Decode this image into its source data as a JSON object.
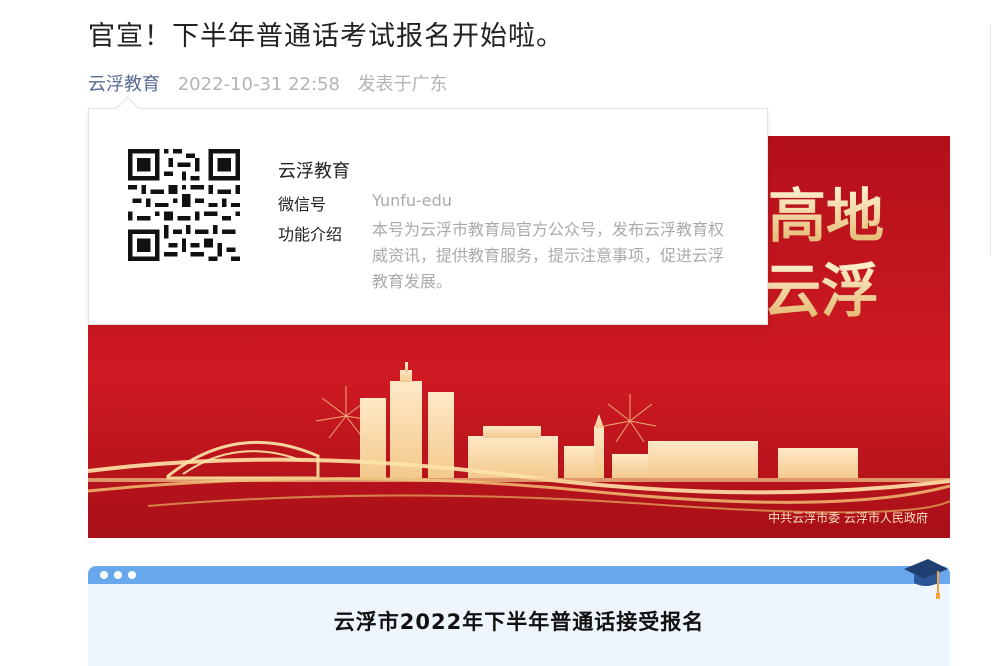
{
  "article": {
    "title": "官宣！下半年普通话考试报名开始啦。",
    "author": "云浮教育",
    "date": "2022-10-31 22:58",
    "location": "发表于广东"
  },
  "banner": {
    "headline_part1": "高地",
    "headline_part2": "云浮",
    "credit": "中共云浮市委  云浮市人民政府"
  },
  "profile_popup": {
    "name": "云浮教育",
    "wechat_label": "微信号",
    "wechat_id": "Yunfu-edu",
    "intro_label": "功能介绍",
    "intro": "本号为云浮市教育局官方公众号，发布云浮教育权威资讯，提供教育服务，提示注意事项，促进云浮教育发展。"
  },
  "card": {
    "title": "云浮市2022年下半年普通话接受报名"
  },
  "colors": {
    "author_link": "#576b95",
    "banner_red": "#c4141b",
    "gold": "#f1cf8c",
    "card_bar": "#6aa8ee",
    "card_bg": "#eef5fd"
  }
}
